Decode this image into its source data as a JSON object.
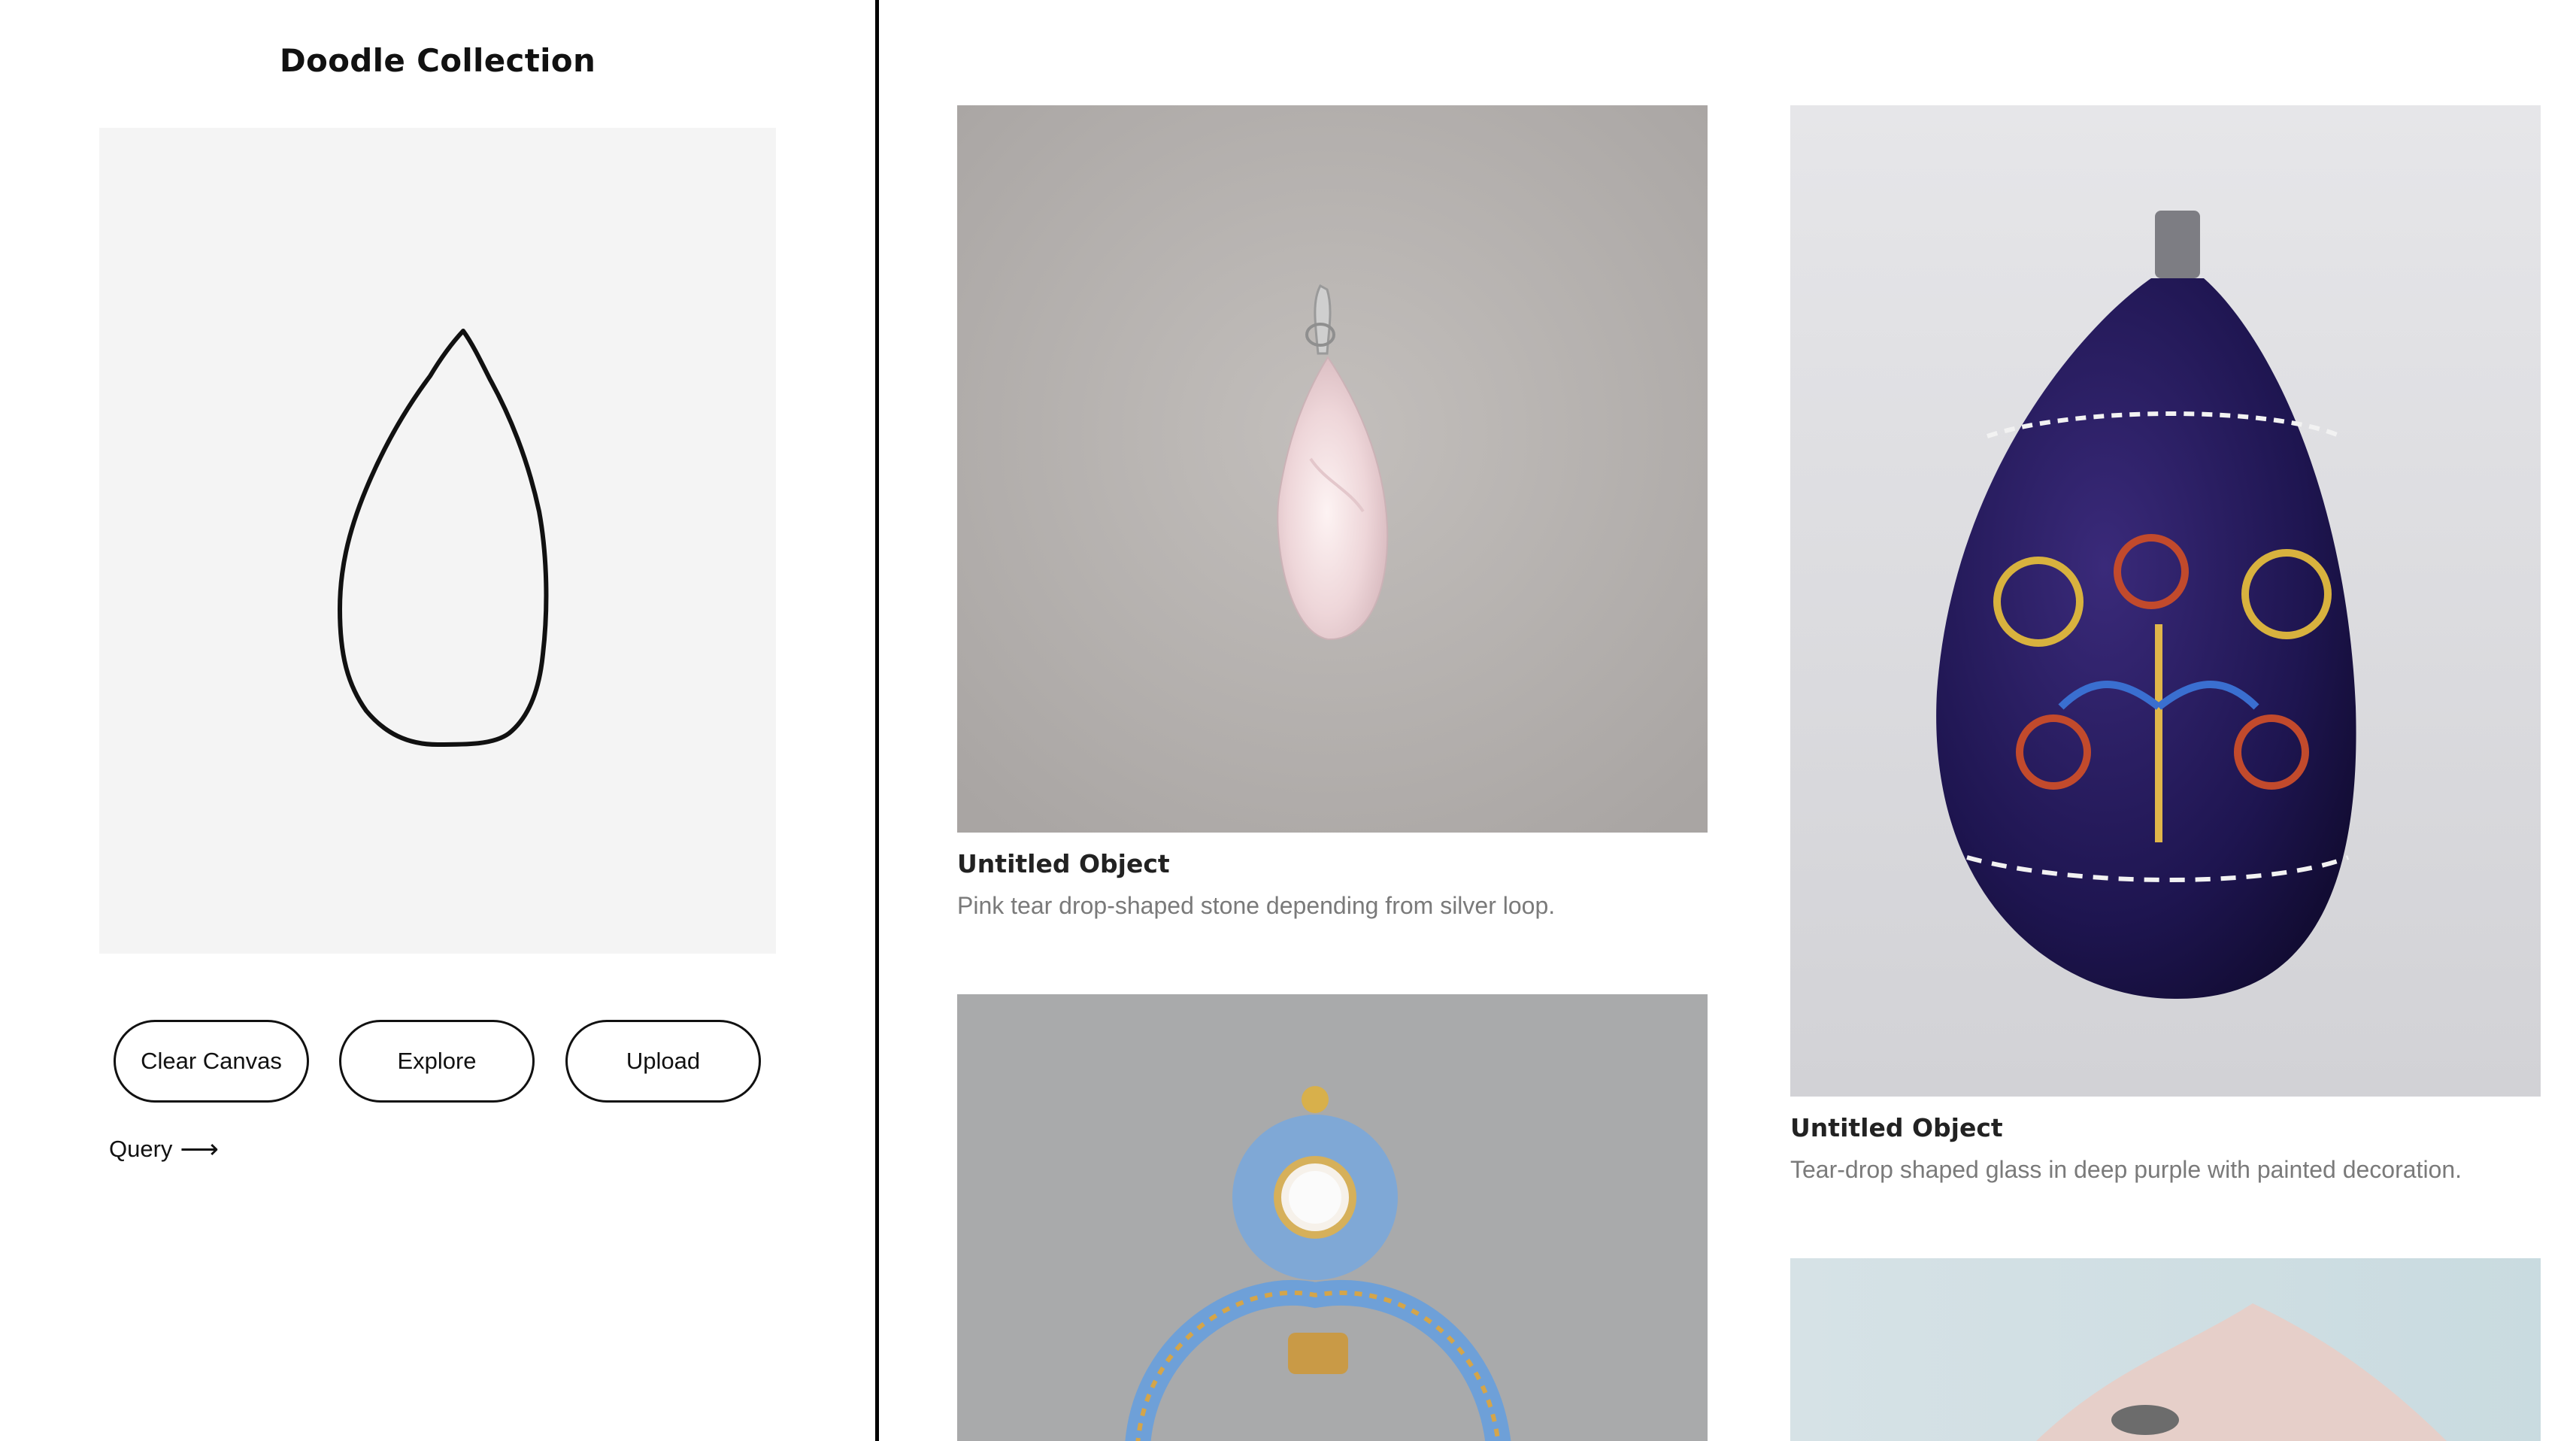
{
  "sidebar": {
    "title": "Doodle Collection",
    "buttons": {
      "clear": "Clear Canvas",
      "explore": "Explore",
      "upload": "Upload"
    },
    "query_label": "Query",
    "query_arrow": "⟶"
  },
  "gallery": {
    "items": [
      {
        "title": "Untitled Object",
        "description": "Pink tear drop-shaped stone depending from silver loop."
      },
      {
        "title": "Untitled Object",
        "description": "Tear-drop shaped glass in deep purple with painted decoration."
      },
      {
        "title": "",
        "description": ""
      },
      {
        "title": "",
        "description": ""
      }
    ]
  }
}
